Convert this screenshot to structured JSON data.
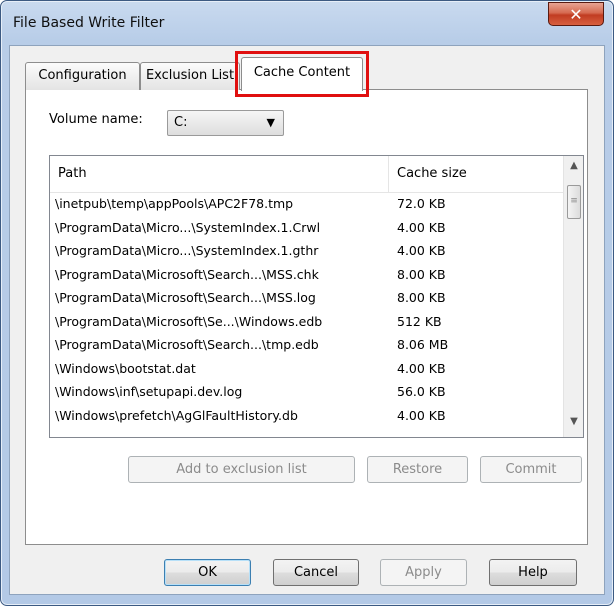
{
  "window": {
    "title": "File Based Write Filter",
    "close_glyph": "✕"
  },
  "tabs": [
    {
      "label": "Configuration"
    },
    {
      "label": "Exclusion List"
    },
    {
      "label": "Cache Content"
    }
  ],
  "volume": {
    "label": "Volume name:",
    "value": "C:"
  },
  "list": {
    "columns": [
      "Path",
      "Cache size"
    ],
    "rows": [
      {
        "path": "\\inetpub\\temp\\appPools\\APC2F78.tmp",
        "size": "72.0 KB"
      },
      {
        "path": "\\ProgramData\\Micro...\\SystemIndex.1.Crwl",
        "size": "4.00 KB"
      },
      {
        "path": "\\ProgramData\\Micro...\\SystemIndex.1.gthr",
        "size": "4.00 KB"
      },
      {
        "path": "\\ProgramData\\Microsoft\\Search...\\MSS.chk",
        "size": "8.00 KB"
      },
      {
        "path": "\\ProgramData\\Microsoft\\Search...\\MSS.log",
        "size": "8.00 KB"
      },
      {
        "path": "\\ProgramData\\Microsoft\\Se...\\Windows.edb",
        "size": "512 KB"
      },
      {
        "path": "\\ProgramData\\Microsoft\\Search...\\tmp.edb",
        "size": "8.06 MB"
      },
      {
        "path": "\\Windows\\bootstat.dat",
        "size": "4.00 KB"
      },
      {
        "path": "\\Windows\\inf\\setupapi.dev.log",
        "size": "56.0 KB"
      },
      {
        "path": "\\Windows\\prefetch\\AgGlFaultHistory.db",
        "size": "4.00 KB"
      }
    ]
  },
  "actions": {
    "add_label": "Add to exclusion list",
    "restore_label": "Restore",
    "commit_label": "Commit"
  },
  "footer": {
    "ok_label": "OK",
    "cancel_label": "Cancel",
    "apply_label": "Apply",
    "help_label": "Help"
  },
  "colors": {
    "highlight": "#e00f0f",
    "window_frame": "#b8cde8"
  }
}
